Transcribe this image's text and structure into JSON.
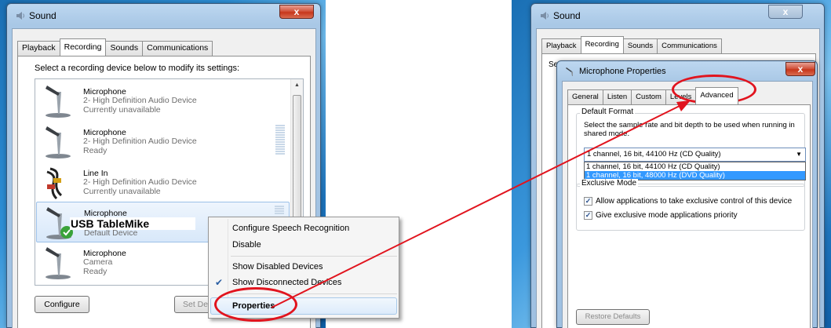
{
  "left_window": {
    "title": "Sound",
    "close": "x",
    "tabs": [
      "Playback",
      "Recording",
      "Sounds",
      "Communications"
    ],
    "active_tab": "Recording",
    "instruction": "Select a recording device below to modify its settings:",
    "devices": [
      {
        "name": "Microphone",
        "desc": "2- High Definition Audio Device",
        "status": "Currently unavailable"
      },
      {
        "name": "Microphone",
        "desc": "2- High Definition Audio Device",
        "status": "Ready"
      },
      {
        "name": "Line In",
        "desc": "2- High Definition Audio Device",
        "status": "Currently unavailable"
      },
      {
        "name": "Microphone",
        "desc": "USB TableMike",
        "status": "Default Device"
      },
      {
        "name": "Microphone",
        "desc": "Camera",
        "status": "Ready"
      }
    ],
    "configure_label": "Configure",
    "set_default_label": "Set De"
  },
  "context_menu": {
    "items": [
      "Configure Speech Recognition",
      "Disable",
      "Show Disabled Devices",
      "Show Disconnected Devices",
      "Properties"
    ],
    "checked_item": "Show Disconnected Devices"
  },
  "right_window": {
    "title": "Sound",
    "close": "x",
    "tabs": [
      "Playback",
      "Recording",
      "Sounds",
      "Communications"
    ],
    "active_tab": "Recording",
    "behind_text": "Se"
  },
  "properties_dialog": {
    "title": "Microphone Properties",
    "close": "x",
    "tabs": [
      "General",
      "Listen",
      "Custom",
      "Levels",
      "Advanced"
    ],
    "active_tab": "Advanced",
    "default_format": {
      "label": "Default Format",
      "description": "Select the sample rate and bit depth to be used when running in shared mode.",
      "selected": "1 channel, 16 bit, 44100 Hz (CD Quality)",
      "options": [
        "1 channel, 16 bit, 44100 Hz (CD Quality)",
        "1 channel, 16 bit, 48000 Hz (DVD Quality)"
      ],
      "highlighted_option": "1 channel, 16 bit, 48000 Hz (DVD Quality)"
    },
    "exclusive_mode": {
      "label": "Exclusive Mode",
      "checkboxes": [
        {
          "label": "Allow applications to take exclusive control of this device",
          "checked": true
        },
        {
          "label": "Give exclusive mode applications priority",
          "checked": true
        }
      ]
    },
    "restore_defaults_label": "Restore Defaults"
  },
  "colors": {
    "annotation": "#e1141e",
    "selection": "#3399ff"
  }
}
